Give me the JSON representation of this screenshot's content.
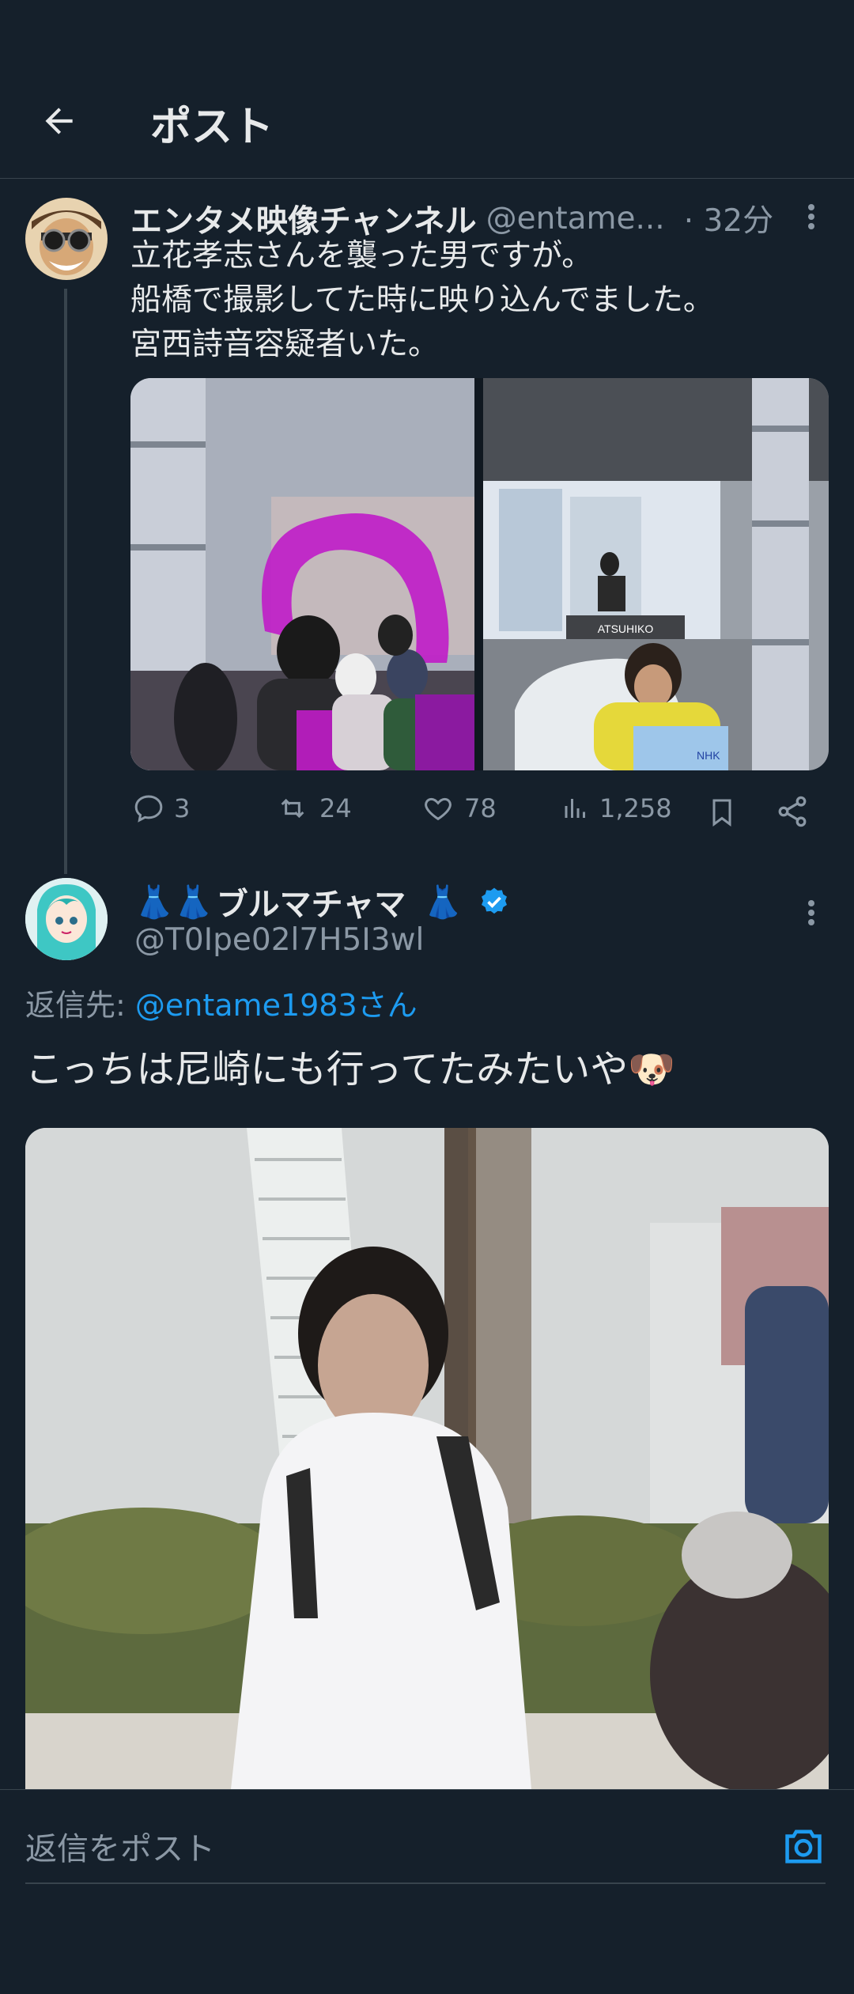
{
  "header": {
    "title": "ポスト",
    "back_icon": "arrow-left-icon"
  },
  "original_post": {
    "author_name": "エンタメ映像チャンネル",
    "author_handle": "@entame...",
    "time": "· 32分",
    "lines": [
      "立花孝志さんを襲った男ですが。",
      "船橋で撮影してた時に映り込んでました。",
      "宮西詩音容疑者いた。"
    ],
    "photo_left_description": "",
    "photo_right_sign": "ATSUHIKO",
    "photo_right_card": "NHK",
    "actions": {
      "replies": "3",
      "reposts": "24",
      "likes": "78",
      "views": "1,258"
    }
  },
  "reply_post": {
    "name_prefix_emoji": "👗👗",
    "author_name": "ブルマチャマ",
    "name_suffix_emoji": "👗",
    "author_handle": "@T0Ipe02l7H5I3wl",
    "reply_to_label": "返信先:",
    "reply_to_mention": "@entame1983さん",
    "text": "こっちは尼崎にも行ってたみたいや🐶"
  },
  "composer": {
    "placeholder": "返信をポスト",
    "camera_icon": "camera-icon"
  },
  "colors": {
    "background": "#15202b",
    "accent": "#1d9bf0",
    "muted": "#8b98a5",
    "divider": "#38444d",
    "highlight": "#c01cc8"
  }
}
